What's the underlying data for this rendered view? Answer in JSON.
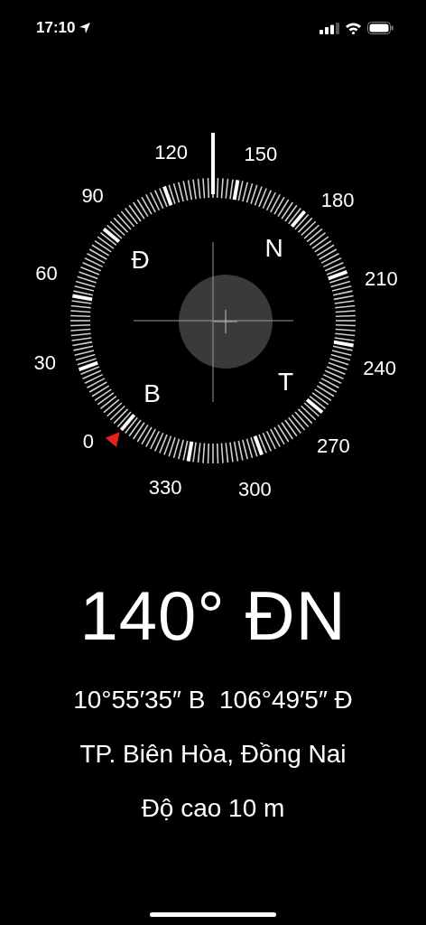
{
  "status_bar": {
    "time": "17:10"
  },
  "compass": {
    "degree_labels": [
      "0",
      "30",
      "60",
      "90",
      "120",
      "150",
      "180",
      "210",
      "240",
      "270",
      "300",
      "330"
    ],
    "cardinal_labels": [
      {
        "kind": "east",
        "text": "Đ"
      },
      {
        "kind": "south",
        "text": "N"
      },
      {
        "kind": "north",
        "text": "B"
      },
      {
        "kind": "west",
        "text": "T"
      }
    ]
  },
  "heading": {
    "reading": "140° ĐN"
  },
  "location": {
    "coordinates": "10°55′35″ B  106°49′5″ Đ",
    "place": "TP. Biên Hòa, Đồng Nai",
    "altitude": "Độ cao 10 m"
  }
}
